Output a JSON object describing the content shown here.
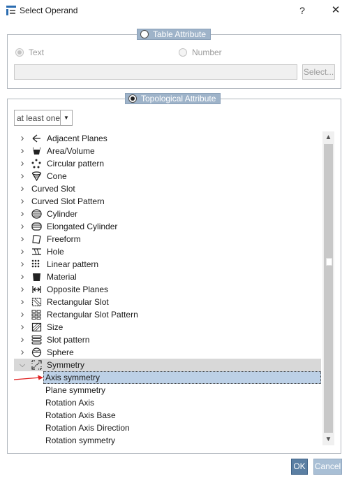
{
  "window": {
    "title": "Select Operand",
    "help_label": "?",
    "close_label": "✕"
  },
  "table_attribute": {
    "legend": "Table Attribute",
    "selected": false,
    "enabled": false,
    "text_option": "Text",
    "number_option": "Number",
    "text_selected": true,
    "value": "",
    "select_button": "Select..."
  },
  "topological_attribute": {
    "legend": "Topological Attribute",
    "selected": true,
    "mode_dropdown": {
      "value": "at least one",
      "arrow": "▼"
    }
  },
  "tree": {
    "items": [
      {
        "label": "Adjacent Planes",
        "expandable": true,
        "icon": "adjacent-planes-icon",
        "level": 0
      },
      {
        "label": "Area/Volume",
        "expandable": true,
        "icon": "area-volume-icon",
        "level": 0
      },
      {
        "label": "Circular pattern",
        "expandable": true,
        "icon": "circular-pattern-icon",
        "level": 0
      },
      {
        "label": "Cone",
        "expandable": true,
        "icon": "cone-icon",
        "level": 0
      },
      {
        "label": "Curved Slot",
        "expandable": true,
        "icon": "",
        "level": 0
      },
      {
        "label": "Curved Slot Pattern",
        "expandable": true,
        "icon": "",
        "level": 0
      },
      {
        "label": "Cylinder",
        "expandable": true,
        "icon": "cylinder-icon",
        "level": 0
      },
      {
        "label": "Elongated Cylinder",
        "expandable": true,
        "icon": "elongated-cylinder-icon",
        "level": 0
      },
      {
        "label": "Freeform",
        "expandable": true,
        "icon": "freeform-icon",
        "level": 0
      },
      {
        "label": "Hole",
        "expandable": true,
        "icon": "hole-icon",
        "level": 0
      },
      {
        "label": "Linear pattern",
        "expandable": true,
        "icon": "linear-pattern-icon",
        "level": 0
      },
      {
        "label": "Material",
        "expandable": true,
        "icon": "material-icon",
        "level": 0
      },
      {
        "label": "Opposite Planes",
        "expandable": true,
        "icon": "opposite-planes-icon",
        "level": 0
      },
      {
        "label": "Rectangular Slot",
        "expandable": true,
        "icon": "rectangular-slot-icon",
        "level": 0
      },
      {
        "label": "Rectangular Slot Pattern",
        "expandable": true,
        "icon": "rectangular-slot-pattern-icon",
        "level": 0
      },
      {
        "label": "Size",
        "expandable": true,
        "icon": "size-icon",
        "level": 0
      },
      {
        "label": "Slot pattern",
        "expandable": true,
        "icon": "slot-pattern-icon",
        "level": 0
      },
      {
        "label": "Sphere",
        "expandable": true,
        "icon": "sphere-icon",
        "level": 0
      },
      {
        "label": "Symmetry",
        "expandable": true,
        "expanded": true,
        "icon": "symmetry-icon",
        "level": 0,
        "state": "selected-parent"
      },
      {
        "label": "Axis symmetry",
        "expandable": false,
        "icon": "",
        "level": 1,
        "state": "highlighted"
      },
      {
        "label": "Plane symmetry",
        "expandable": false,
        "icon": "",
        "level": 1
      },
      {
        "label": "Rotation Axis",
        "expandable": false,
        "icon": "",
        "level": 1
      },
      {
        "label": "Rotation Axis Base",
        "expandable": false,
        "icon": "",
        "level": 1
      },
      {
        "label": "Rotation Axis Direction",
        "expandable": false,
        "icon": "",
        "level": 1
      },
      {
        "label": "Rotation symmetry",
        "expandable": false,
        "icon": "",
        "level": 1
      }
    ]
  },
  "scrollbar": {
    "up_arrow": "▲",
    "down_arrow": "▼"
  },
  "buttons": {
    "ok": "OK",
    "cancel": "Cancel"
  },
  "colors": {
    "accent": "#5b7fa3",
    "legend_chip": "#9eb3c9",
    "highlight_row": "#bcd0e6",
    "annotation_arrow": "#e02020"
  }
}
